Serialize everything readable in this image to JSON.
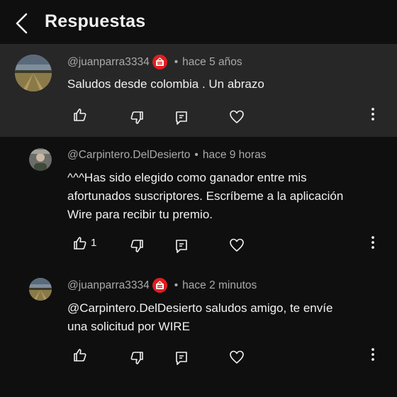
{
  "header": {
    "title": "Respuestas"
  },
  "comments": [
    {
      "author": "@juanparra3334",
      "time": "hace 5 años",
      "text": "Saludos desde colombia . Un abrazo",
      "likes": ""
    },
    {
      "author": "@Carpintero.DelDesierto",
      "time": "hace 9 horas",
      "text_lines": [
        "^^^Has sido elegido como ganador entre mis",
        "afortunados suscriptores. Escríbeme a la aplicación",
        "Wire para recibir tu premio."
      ],
      "likes": "1"
    },
    {
      "author": "@juanparra3334",
      "time": "hace 2 minutos",
      "text_lines": [
        "@Carpintero.DelDesierto  saludos amigo, te envíe",
        "una solicitud  por WIRE"
      ],
      "likes": ""
    }
  ],
  "colors": {
    "background": "#0f0f0f",
    "highlight": "#272727",
    "badge": "#e31d1d",
    "meta": "#aaaaaa"
  },
  "separator": "•"
}
